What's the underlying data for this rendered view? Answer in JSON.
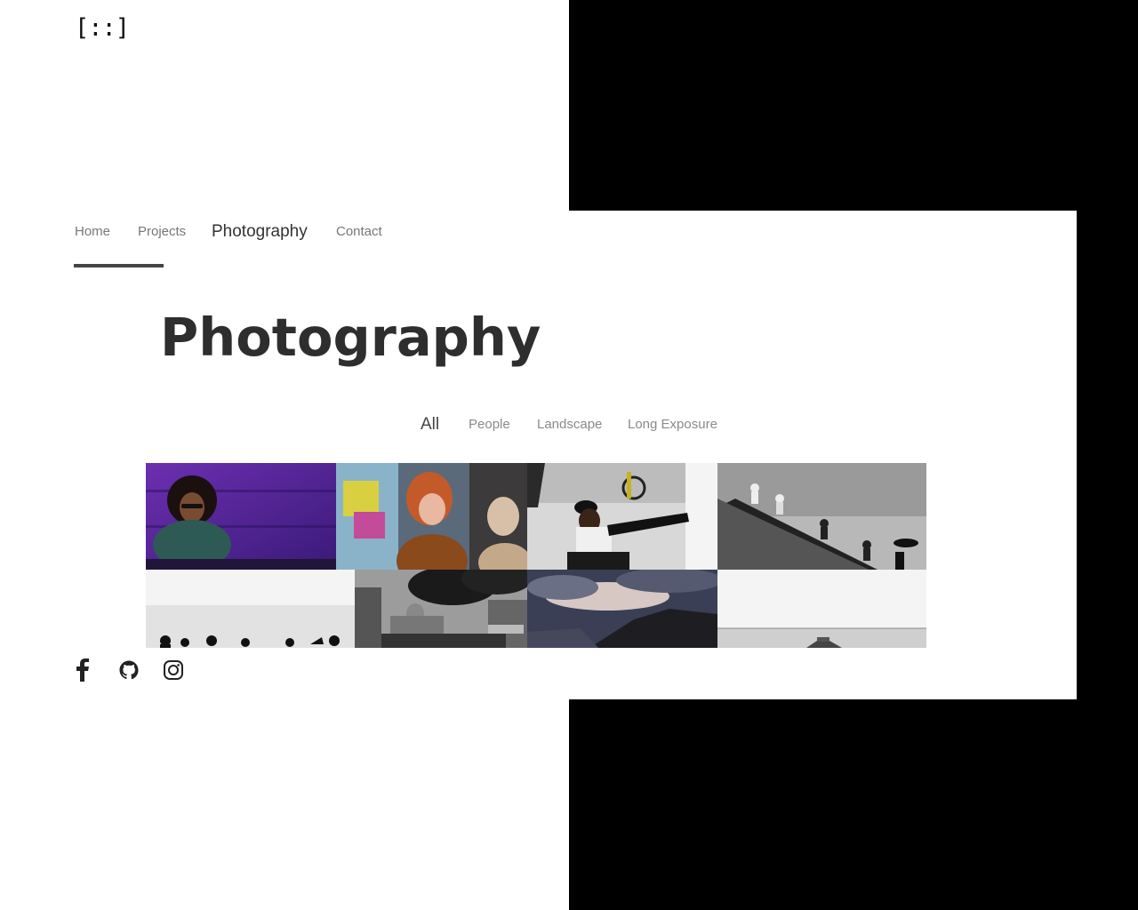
{
  "logo": {
    "text": "[::]"
  },
  "nav": {
    "items": [
      {
        "label": "Home"
      },
      {
        "label": "Projects"
      },
      {
        "label": "Photography",
        "active": true
      },
      {
        "label": "Contact"
      }
    ]
  },
  "page": {
    "title": "Photography"
  },
  "filters": {
    "items": [
      {
        "label": "All",
        "active": true
      },
      {
        "label": "People"
      },
      {
        "label": "Landscape"
      },
      {
        "label": "Long Exposure"
      }
    ]
  },
  "gallery": {
    "tiles": [
      {
        "name": "photo-woman-purple-wall"
      },
      {
        "name": "photo-women-laughing-graffiti"
      },
      {
        "name": "photo-man-stretching-bike"
      },
      {
        "name": "photo-people-on-stairs-bw"
      },
      {
        "name": "photo-silhouettes-beach-bw"
      },
      {
        "name": "photo-city-street-cathedral-bw"
      },
      {
        "name": "photo-cloudy-cliffs"
      },
      {
        "name": "photo-pier-sea-bw"
      }
    ]
  },
  "social": {
    "icons": [
      "facebook-icon",
      "github-icon",
      "instagram-icon"
    ]
  },
  "colors": {
    "text_dark": "#2e2e2e",
    "text_muted": "#777777",
    "panel": "#000000"
  }
}
